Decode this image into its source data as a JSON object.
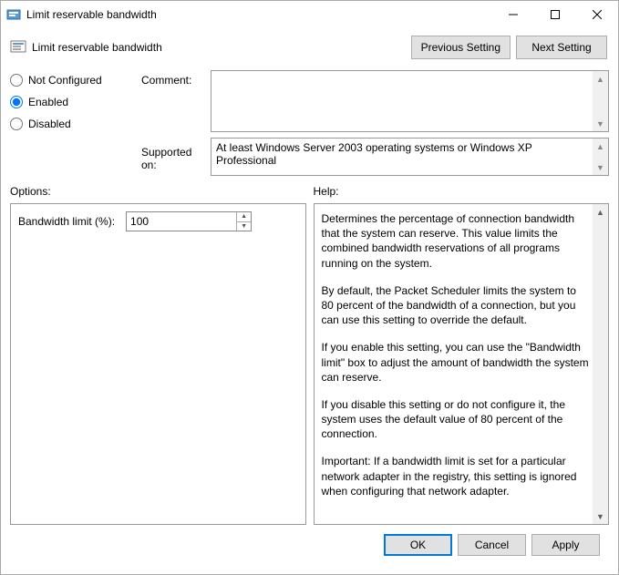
{
  "window": {
    "title": "Limit reservable bandwidth"
  },
  "policy": {
    "title": "Limit reservable bandwidth"
  },
  "nav": {
    "prev": "Previous Setting",
    "next": "Next Setting"
  },
  "state": {
    "not_configured": "Not Configured",
    "enabled": "Enabled",
    "disabled": "Disabled",
    "selected": "enabled"
  },
  "labels": {
    "comment": "Comment:",
    "supported": "Supported on:",
    "options": "Options:",
    "help": "Help:"
  },
  "comment": "",
  "supported": "At least Windows Server 2003 operating systems or Windows XP Professional",
  "options": {
    "bandwidth_label": "Bandwidth limit (%):",
    "bandwidth_value": "100"
  },
  "help": {
    "p1": "Determines the percentage of connection bandwidth that the system can reserve. This value limits the combined bandwidth reservations of all programs running on the system.",
    "p2": "By default, the Packet Scheduler limits the system to 80 percent of the bandwidth of a connection, but you can use this setting to override the default.",
    "p3": "If you enable this setting, you can use the \"Bandwidth limit\" box to adjust the amount of bandwidth the system can reserve.",
    "p4": "If you disable this setting or do not configure it, the system uses the default value of 80 percent of the connection.",
    "p5": "Important: If a bandwidth limit is set for a particular network adapter in the registry, this setting is ignored when configuring that network adapter."
  },
  "buttons": {
    "ok": "OK",
    "cancel": "Cancel",
    "apply": "Apply"
  }
}
